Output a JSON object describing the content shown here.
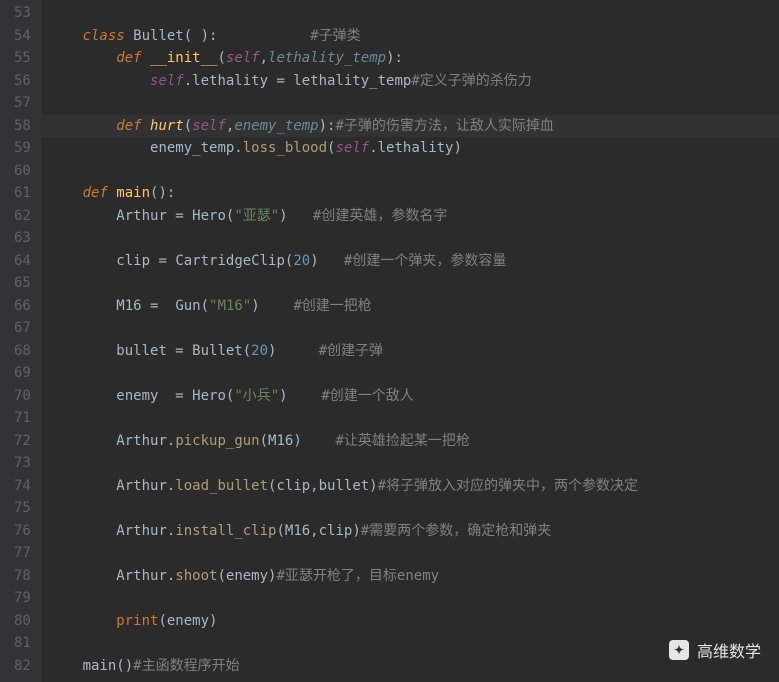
{
  "gutter": [
    "53",
    "54",
    "55",
    "56",
    "57",
    "58",
    "59",
    "60",
    "61",
    "62",
    "63",
    "64",
    "65",
    "66",
    "67",
    "68",
    "69",
    "70",
    "71",
    "72",
    "73",
    "74",
    "75",
    "76",
    "77",
    "78",
    "79",
    "80",
    "81",
    "82"
  ],
  "highlighted_line": 58,
  "c": {
    "l54a": "class ",
    "l54b": "Bullet",
    "l54c": "( ):",
    "l54d": "           #子弹类",
    "l55a": "def ",
    "l55b": "__init__",
    "l55c": "(",
    "l55d": "self",
    "l55e": ",",
    "l55f": "lethality_temp",
    "l55g": "):",
    "l56a": "self",
    "l56b": ".lethality = lethality_temp",
    "l56c": "#定义子弹的杀伤力",
    "l58a": "def ",
    "l58b": "hurt",
    "l58c": "(",
    "l58d": "self",
    "l58e": ",",
    "l58f": "enemy_temp",
    "l58g": "):",
    "l58h": "#子弹的伤害方法，让敌人实际掉血",
    "l59a": "enemy_temp.",
    "l59b": "loss_blood",
    "l59c": "(",
    "l59d": "self",
    "l59e": ".lethality)",
    "l61a": "def ",
    "l61b": "main",
    "l61c": "():",
    "l62a": "Arthur = ",
    "l62b": "Hero",
    "l62c": "(",
    "l62d": "\"亚瑟\"",
    "l62e": ")   ",
    "l62f": "#创建英雄，参数名字",
    "l64a": "clip = ",
    "l64b": "CartridgeClip",
    "l64c": "(",
    "l64d": "20",
    "l64e": ")   ",
    "l64f": "#创建一个弹夹，参数容量",
    "l66a": "M16 =  ",
    "l66b": "Gun",
    "l66c": "(",
    "l66d": "\"M16\"",
    "l66e": ")    ",
    "l66f": "#创建一把枪",
    "l68a": "bullet = ",
    "l68b": "Bullet",
    "l68c": "(",
    "l68d": "20",
    "l68e": ")     ",
    "l68f": "#创建子弹",
    "l70a": "enemy  = ",
    "l70b": "Hero",
    "l70c": "(",
    "l70d": "\"小兵\"",
    "l70e": ")    ",
    "l70f": "#创建一个敌人",
    "l72a": "Arthur.",
    "l72b": "pickup_gun",
    "l72c": "(M16)    ",
    "l72f": "#让英雄捡起某一把枪",
    "l74a": "Arthur.",
    "l74b": "load_bullet",
    "l74c": "(clip,bullet)",
    "l74f": "#将子弹放入对应的弹夹中，两个参数决定",
    "l76a": "Arthur.",
    "l76b": "install_clip",
    "l76c": "(M16,clip)",
    "l76f": "#需要两个参数，确定枪和弹夹",
    "l78a": "Arthur.",
    "l78b": "shoot",
    "l78c": "(enemy)",
    "l78f": "#亚瑟开枪了，目标enemy",
    "l80a": "print",
    "l80b": "(enemy)",
    "l82a": "main",
    "l82b": "()",
    "l82c": "#主函数程序开始"
  },
  "watermark": "高维数学"
}
